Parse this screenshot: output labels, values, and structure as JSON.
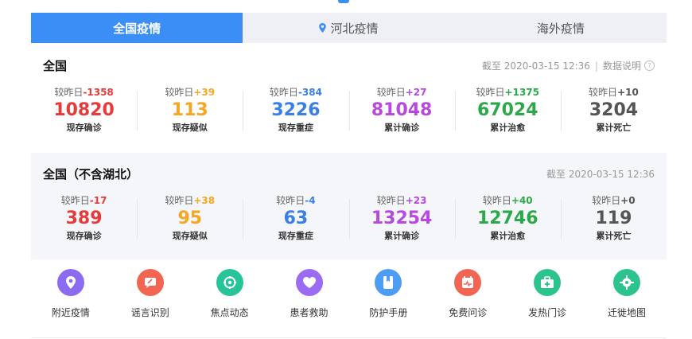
{
  "tabs": [
    {
      "label": "全国疫情"
    },
    {
      "label": "河北疫情"
    },
    {
      "label": "海外疫情"
    }
  ],
  "colors": {
    "accent": "#3a8ef6",
    "red": "#e83a3a",
    "orange": "#f5a623",
    "blue": "#3a7ee8",
    "purple": "#b748e0",
    "green": "#2ba84a",
    "gray": "#555555"
  },
  "national": {
    "title": "全国",
    "meta": "截至 2020-03-15 12:36",
    "meta_link": "数据说明",
    "stats": [
      {
        "prefix": "较昨日",
        "delta": "-1358",
        "value": "10820",
        "label": "现存确诊"
      },
      {
        "prefix": "较昨日",
        "delta": "+39",
        "value": "113",
        "label": "现存疑似"
      },
      {
        "prefix": "较昨日",
        "delta": "-384",
        "value": "3226",
        "label": "现存重症"
      },
      {
        "prefix": "较昨日",
        "delta": "+27",
        "value": "81048",
        "label": "累计确诊"
      },
      {
        "prefix": "较昨日",
        "delta": "+1375",
        "value": "67024",
        "label": "累计治愈"
      },
      {
        "prefix": "较昨日",
        "delta": "+10",
        "value": "3204",
        "label": "累计死亡"
      }
    ]
  },
  "excl_hubei": {
    "title": "全国（不含湖北）",
    "meta": "截至 2020-03-15 12:36",
    "stats": [
      {
        "prefix": "较昨日",
        "delta": "-17",
        "value": "389",
        "label": "现存确诊"
      },
      {
        "prefix": "较昨日",
        "delta": "+38",
        "value": "95",
        "label": "现存疑似"
      },
      {
        "prefix": "较昨日",
        "delta": "-4",
        "value": "63",
        "label": "现存重症"
      },
      {
        "prefix": "较昨日",
        "delta": "+23",
        "value": "13254",
        "label": "累计确诊"
      },
      {
        "prefix": "较昨日",
        "delta": "+40",
        "value": "12746",
        "label": "累计治愈"
      },
      {
        "prefix": "较昨日",
        "delta": "+0",
        "value": "119",
        "label": "累计死亡"
      }
    ]
  },
  "tools": [
    {
      "label": "附近疫情",
      "icon": "location-pin-icon",
      "color": "#8b6cf0"
    },
    {
      "label": "谣言识别",
      "icon": "rumor-icon",
      "color": "#f26552"
    },
    {
      "label": "焦点动态",
      "icon": "focus-news-icon",
      "color": "#27c49a"
    },
    {
      "label": "患者救助",
      "icon": "heart-icon",
      "color": "#9b6cf2"
    },
    {
      "label": "防护手册",
      "icon": "handbook-icon",
      "color": "#4d9df5"
    },
    {
      "label": "免费问诊",
      "icon": "calendar-consult-icon",
      "color": "#f26552"
    },
    {
      "label": "发热门诊",
      "icon": "medical-kit-icon",
      "color": "#2cc38e"
    },
    {
      "label": "迁徙地图",
      "icon": "map-target-icon",
      "color": "#2cc38e"
    }
  ]
}
